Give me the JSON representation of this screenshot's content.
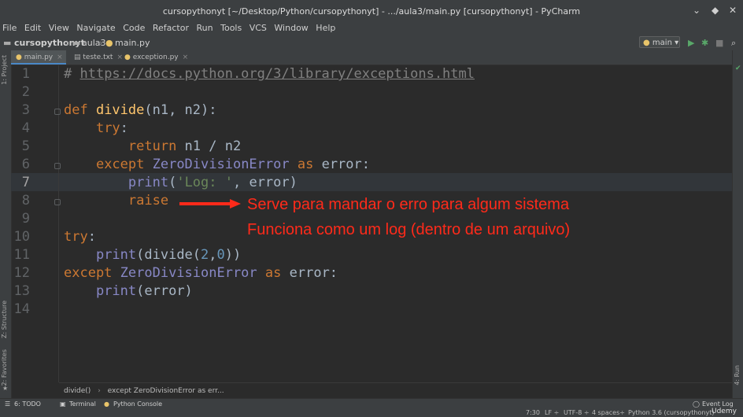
{
  "window": {
    "title": "cursopythonyt [~/Desktop/Python/cursopythonyt] - .../aula3/main.py [cursopythonyt] - PyCharm"
  },
  "menu": [
    "File",
    "Edit",
    "View",
    "Navigate",
    "Code",
    "Refactor",
    "Run",
    "Tools",
    "VCS",
    "Window",
    "Help"
  ],
  "nav": {
    "project": "cursopythonyt",
    "folder": "aula3",
    "file": "main.py",
    "run_config": "main"
  },
  "tabs": [
    {
      "label": "main.py",
      "active": true
    },
    {
      "label": "teste.txt",
      "active": false
    },
    {
      "label": "exception.py",
      "active": false
    }
  ],
  "side_tools": {
    "project": "1: Project",
    "structure": "Z: Structure",
    "favorites": "2: Favorites",
    "run": "4: Run"
  },
  "code": {
    "line_numbers": [
      "1",
      "2",
      "3",
      "4",
      "5",
      "6",
      "7",
      "8",
      "9",
      "10",
      "11",
      "12",
      "13",
      "14"
    ],
    "url": "https://docs.python.org/3/library/exceptions.html"
  },
  "annotations": [
    "Serve para mandar o erro para algum sistema",
    "Funciona como um log (dentro de um arquivo)"
  ],
  "breadcrumb": {
    "func": "divide()",
    "sep": "›",
    "clause": "except ZeroDivisionError as err..."
  },
  "bottom_tools": {
    "todo": "6: TODO",
    "terminal": "Terminal",
    "console": "Python Console",
    "event_log": "Event Log"
  },
  "status": {
    "position": "7:30",
    "line_sep": "LF ÷",
    "encoding": "UTF-8 ÷",
    "indent": "4 spaces÷",
    "interpreter": "Python 3.6 (cursopythonyt)"
  },
  "watermark": "Udemy"
}
